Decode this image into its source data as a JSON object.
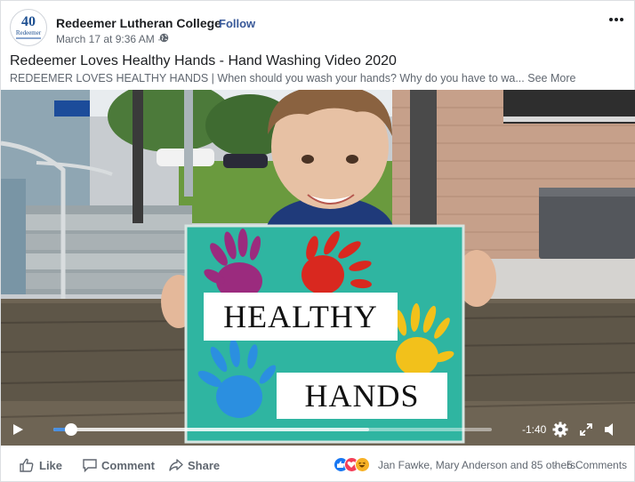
{
  "post": {
    "page_name": "Redeemer Lutheran College",
    "separator": "·",
    "follow_label": "Follow",
    "timestamp": "March 17 at 9:36 AM ·",
    "title": "Redeemer Loves Healthy Hands - Hand Washing Video 2020",
    "description": "REDEEMER LOVES HEALTHY HANDS | When should you wash your hands? Why do you have to wa...",
    "see_more": "See More",
    "avatar": {
      "number": "40",
      "name": "Redeemer"
    }
  },
  "video": {
    "sign_line1": "HEALTHY",
    "sign_line2": "HANDS",
    "progress": 0.04,
    "buffered": 0.72,
    "time_remaining": "-1:40",
    "handprint_colors": [
      "#9b2b7e",
      "#d9281f",
      "#f2c11b",
      "#2b8fe0"
    ],
    "sign_color": "#2fb5a1"
  },
  "footer": {
    "like_label": "Like",
    "comment_label": "Comment",
    "share_label": "Share",
    "reactors": "Jan Fawke, Mary Anderson and 85 others",
    "separator": "·",
    "comments_count": "5 Comments",
    "reaction_icons": [
      "like-icon",
      "love-icon",
      "haha-icon"
    ]
  },
  "colors": {
    "link": "#385898",
    "accent": "#1877f2",
    "muted": "#606770"
  }
}
